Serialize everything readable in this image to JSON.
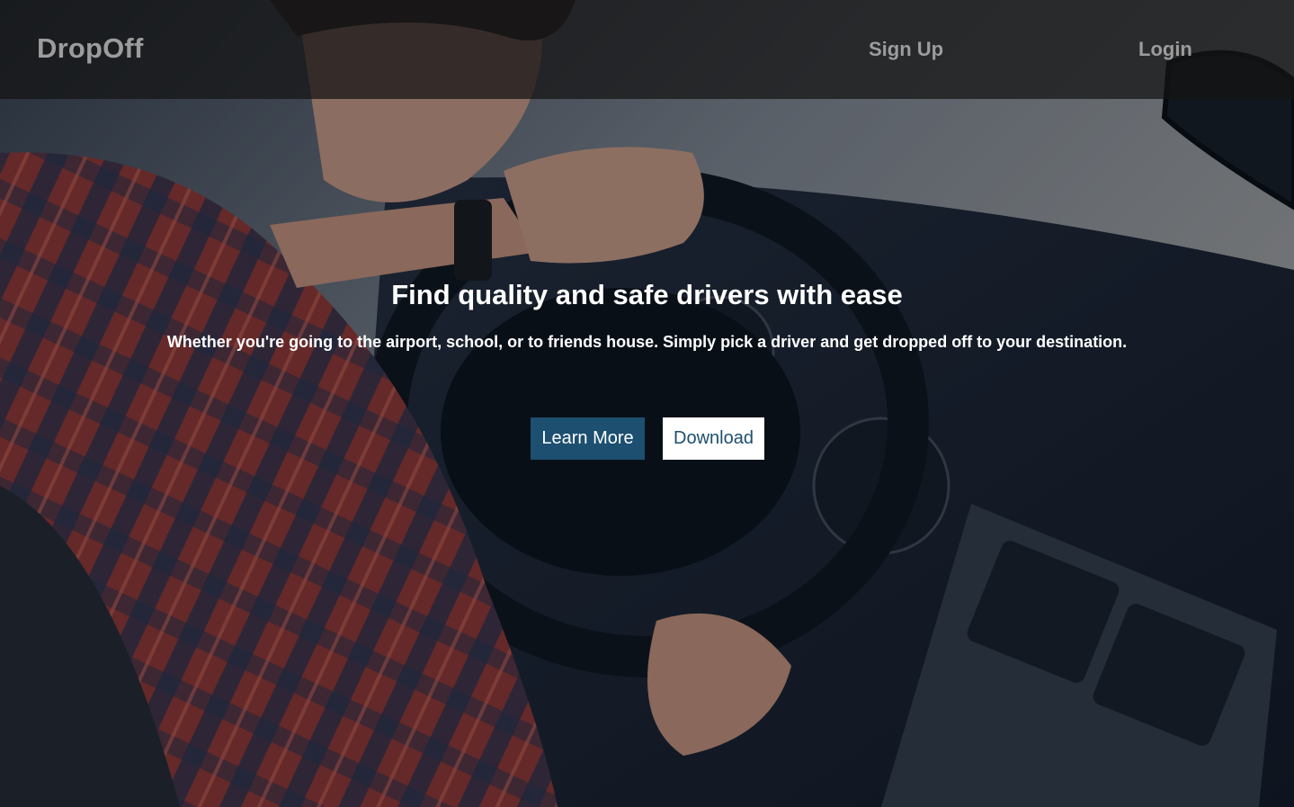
{
  "navbar": {
    "brand": "DropOff",
    "links": [
      {
        "label": "Sign Up"
      },
      {
        "label": "Login"
      }
    ]
  },
  "hero": {
    "title": "Find quality and safe drivers with ease",
    "subtitle": "Whether you're going to the airport, school, or to friends house. Simply pick a driver and get dropped off to your destination.",
    "buttons": {
      "learn_more": "Learn More",
      "download": "Download"
    },
    "background": "photo of a person driving a car, hands on the steering wheel"
  },
  "colors": {
    "primary_button": "#1c4f70",
    "nav_text": "#9c9c9c",
    "nav_bg": "rgba(20,20,20,0.72)"
  }
}
